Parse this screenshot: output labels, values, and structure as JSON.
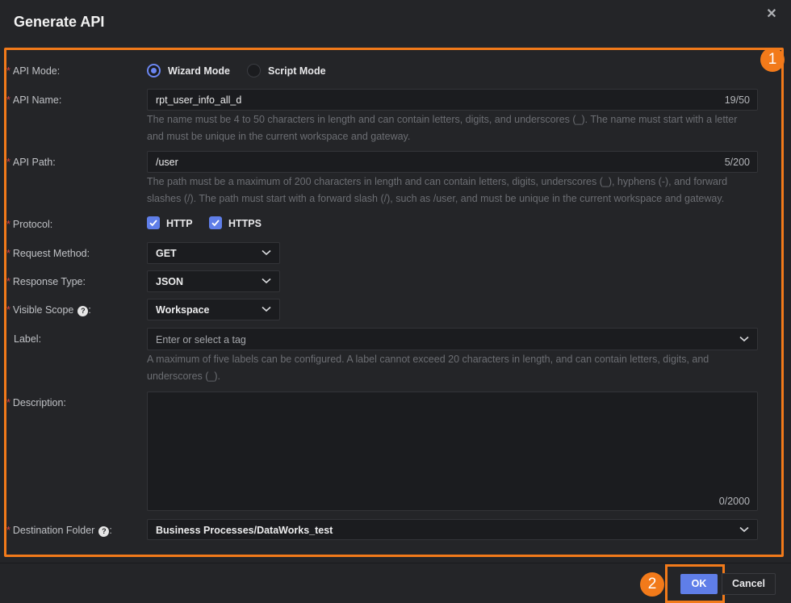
{
  "dialog": {
    "title": "Generate API",
    "close_icon": "close-icon"
  },
  "form": {
    "api_mode": {
      "label": "API Mode:",
      "options": [
        {
          "label": "Wizard Mode",
          "selected": true
        },
        {
          "label": "Script Mode",
          "selected": false
        }
      ]
    },
    "api_name": {
      "label": "API Name:",
      "value": "rpt_user_info_all_d",
      "counter": "19/50",
      "help_line1": "The name must be 4 to 50 characters in length and can contain letters, digits, and underscores (_). The name must start with a letter",
      "help_line2": "and must be unique in the current workspace and gateway."
    },
    "api_path": {
      "label": "API Path:",
      "value": "/user",
      "counter": "5/200",
      "help_line1": "The path must be a maximum of 200 characters in length and can contain letters, digits, underscores (_), hyphens (-), and forward",
      "help_line2": "slashes (/). The path must start with a forward slash (/), such as /user, and must be unique in the current workspace and gateway."
    },
    "protocol": {
      "label": "Protocol:",
      "options": [
        {
          "label": "HTTP",
          "checked": true
        },
        {
          "label": "HTTPS",
          "checked": true
        }
      ]
    },
    "request_method": {
      "label": "Request Method:",
      "value": "GET"
    },
    "response_type": {
      "label": "Response Type:",
      "value": "JSON"
    },
    "visible_scope": {
      "label": "Visible Scope",
      "suffix": ":",
      "value": "Workspace"
    },
    "label_field": {
      "label": "Label:",
      "placeholder": "Enter or select a tag",
      "help_line1": "A maximum of five labels can be configured. A label cannot exceed 20 characters in length, and can contain letters, digits, and",
      "help_line2": "underscores (_)."
    },
    "description": {
      "label": "Description:",
      "counter": "0/2000"
    },
    "destination_folder": {
      "label": "Destination Folder",
      "suffix": ":",
      "value": "Business Processes/DataWorks_test"
    }
  },
  "annotations": {
    "badge1": "1",
    "badge2": "2"
  },
  "footer": {
    "ok_label": "OK",
    "cancel_label": "Cancel"
  },
  "colors": {
    "accent": "#5f7ee8",
    "highlight": "#f27a1a",
    "required": "#e0463d"
  }
}
